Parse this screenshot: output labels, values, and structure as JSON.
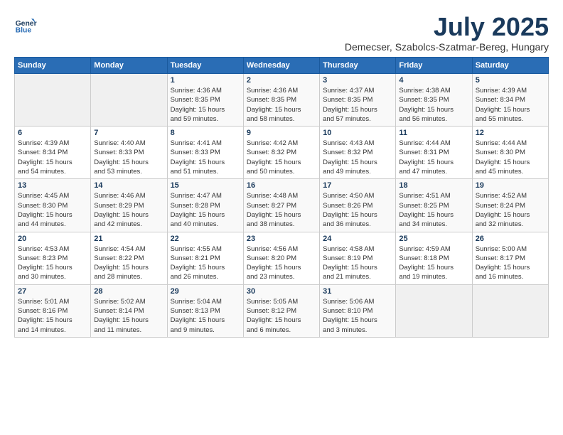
{
  "logo": {
    "line1": "General",
    "line2": "Blue"
  },
  "title": "July 2025",
  "location": "Demecser, Szabolcs-Szatmar-Bereg, Hungary",
  "weekdays": [
    "Sunday",
    "Monday",
    "Tuesday",
    "Wednesday",
    "Thursday",
    "Friday",
    "Saturday"
  ],
  "weeks": [
    [
      {
        "day": "",
        "detail": ""
      },
      {
        "day": "",
        "detail": ""
      },
      {
        "day": "1",
        "detail": "Sunrise: 4:36 AM\nSunset: 8:35 PM\nDaylight: 15 hours\nand 59 minutes."
      },
      {
        "day": "2",
        "detail": "Sunrise: 4:36 AM\nSunset: 8:35 PM\nDaylight: 15 hours\nand 58 minutes."
      },
      {
        "day": "3",
        "detail": "Sunrise: 4:37 AM\nSunset: 8:35 PM\nDaylight: 15 hours\nand 57 minutes."
      },
      {
        "day": "4",
        "detail": "Sunrise: 4:38 AM\nSunset: 8:35 PM\nDaylight: 15 hours\nand 56 minutes."
      },
      {
        "day": "5",
        "detail": "Sunrise: 4:39 AM\nSunset: 8:34 PM\nDaylight: 15 hours\nand 55 minutes."
      }
    ],
    [
      {
        "day": "6",
        "detail": "Sunrise: 4:39 AM\nSunset: 8:34 PM\nDaylight: 15 hours\nand 54 minutes."
      },
      {
        "day": "7",
        "detail": "Sunrise: 4:40 AM\nSunset: 8:33 PM\nDaylight: 15 hours\nand 53 minutes."
      },
      {
        "day": "8",
        "detail": "Sunrise: 4:41 AM\nSunset: 8:33 PM\nDaylight: 15 hours\nand 51 minutes."
      },
      {
        "day": "9",
        "detail": "Sunrise: 4:42 AM\nSunset: 8:32 PM\nDaylight: 15 hours\nand 50 minutes."
      },
      {
        "day": "10",
        "detail": "Sunrise: 4:43 AM\nSunset: 8:32 PM\nDaylight: 15 hours\nand 49 minutes."
      },
      {
        "day": "11",
        "detail": "Sunrise: 4:44 AM\nSunset: 8:31 PM\nDaylight: 15 hours\nand 47 minutes."
      },
      {
        "day": "12",
        "detail": "Sunrise: 4:44 AM\nSunset: 8:30 PM\nDaylight: 15 hours\nand 45 minutes."
      }
    ],
    [
      {
        "day": "13",
        "detail": "Sunrise: 4:45 AM\nSunset: 8:30 PM\nDaylight: 15 hours\nand 44 minutes."
      },
      {
        "day": "14",
        "detail": "Sunrise: 4:46 AM\nSunset: 8:29 PM\nDaylight: 15 hours\nand 42 minutes."
      },
      {
        "day": "15",
        "detail": "Sunrise: 4:47 AM\nSunset: 8:28 PM\nDaylight: 15 hours\nand 40 minutes."
      },
      {
        "day": "16",
        "detail": "Sunrise: 4:48 AM\nSunset: 8:27 PM\nDaylight: 15 hours\nand 38 minutes."
      },
      {
        "day": "17",
        "detail": "Sunrise: 4:50 AM\nSunset: 8:26 PM\nDaylight: 15 hours\nand 36 minutes."
      },
      {
        "day": "18",
        "detail": "Sunrise: 4:51 AM\nSunset: 8:25 PM\nDaylight: 15 hours\nand 34 minutes."
      },
      {
        "day": "19",
        "detail": "Sunrise: 4:52 AM\nSunset: 8:24 PM\nDaylight: 15 hours\nand 32 minutes."
      }
    ],
    [
      {
        "day": "20",
        "detail": "Sunrise: 4:53 AM\nSunset: 8:23 PM\nDaylight: 15 hours\nand 30 minutes."
      },
      {
        "day": "21",
        "detail": "Sunrise: 4:54 AM\nSunset: 8:22 PM\nDaylight: 15 hours\nand 28 minutes."
      },
      {
        "day": "22",
        "detail": "Sunrise: 4:55 AM\nSunset: 8:21 PM\nDaylight: 15 hours\nand 26 minutes."
      },
      {
        "day": "23",
        "detail": "Sunrise: 4:56 AM\nSunset: 8:20 PM\nDaylight: 15 hours\nand 23 minutes."
      },
      {
        "day": "24",
        "detail": "Sunrise: 4:58 AM\nSunset: 8:19 PM\nDaylight: 15 hours\nand 21 minutes."
      },
      {
        "day": "25",
        "detail": "Sunrise: 4:59 AM\nSunset: 8:18 PM\nDaylight: 15 hours\nand 19 minutes."
      },
      {
        "day": "26",
        "detail": "Sunrise: 5:00 AM\nSunset: 8:17 PM\nDaylight: 15 hours\nand 16 minutes."
      }
    ],
    [
      {
        "day": "27",
        "detail": "Sunrise: 5:01 AM\nSunset: 8:16 PM\nDaylight: 15 hours\nand 14 minutes."
      },
      {
        "day": "28",
        "detail": "Sunrise: 5:02 AM\nSunset: 8:14 PM\nDaylight: 15 hours\nand 11 minutes."
      },
      {
        "day": "29",
        "detail": "Sunrise: 5:04 AM\nSunset: 8:13 PM\nDaylight: 15 hours\nand 9 minutes."
      },
      {
        "day": "30",
        "detail": "Sunrise: 5:05 AM\nSunset: 8:12 PM\nDaylight: 15 hours\nand 6 minutes."
      },
      {
        "day": "31",
        "detail": "Sunrise: 5:06 AM\nSunset: 8:10 PM\nDaylight: 15 hours\nand 3 minutes."
      },
      {
        "day": "",
        "detail": ""
      },
      {
        "day": "",
        "detail": ""
      }
    ]
  ]
}
